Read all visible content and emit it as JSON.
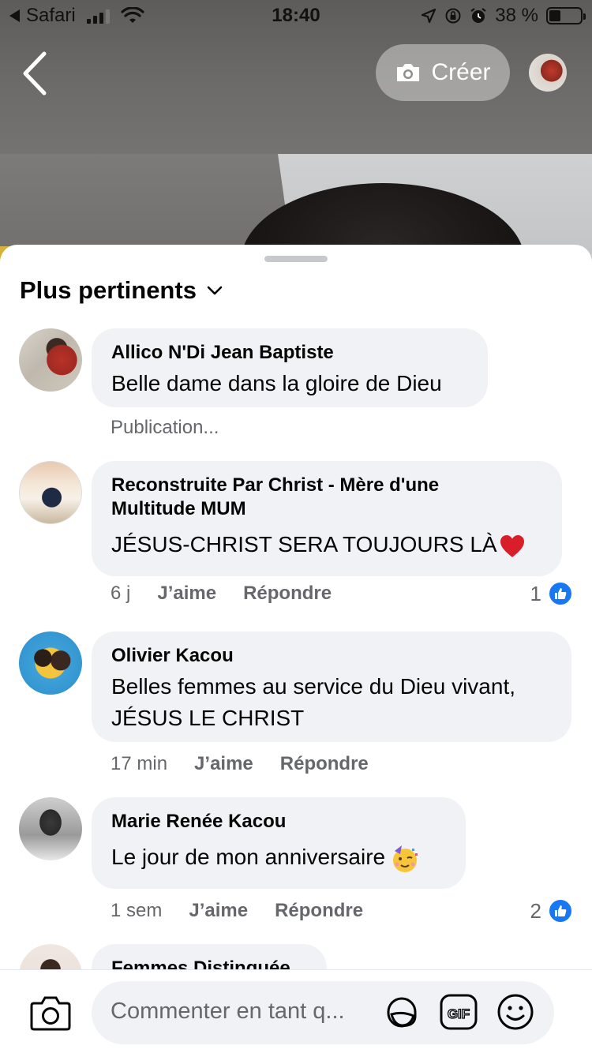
{
  "status_bar": {
    "back_app": "Safari",
    "time": "18:40",
    "battery_percent": "38 %",
    "battery_level": 0.38
  },
  "top_bar": {
    "create_label": "Créer"
  },
  "sheet": {
    "sort_label": "Plus pertinents",
    "comments": [
      {
        "author": "Allico N'Di Jean Baptiste",
        "text": "Belle dame dans la gloire de Dieu",
        "status": "Publication..."
      },
      {
        "author_line1": "Reconstruite Par Christ - Mère d'une",
        "author_line2": "Multitude MUM",
        "text": "JÉSUS-CHRIST SERA TOUJOURS LÀ",
        "emoji": "red-heart",
        "time": "6 j",
        "like": "J’aime",
        "reply": "Répondre",
        "reactions": "1"
      },
      {
        "author": "Olivier Kacou",
        "text_line1": "Belles femmes au service du Dieu vivant,",
        "text_line2": "JÉSUS LE CHRIST",
        "time": "17 min",
        "like": "J’aime",
        "reply": "Répondre"
      },
      {
        "author": "Marie Renée Kacou",
        "text": "Le jour de mon anniversaire",
        "emoji": "partying-face",
        "time": "1 sem",
        "like": "J’aime",
        "reply": "Répondre",
        "reactions": "2"
      },
      {
        "author": "Femmes Distinguée"
      }
    ]
  },
  "composer": {
    "placeholder": "Commenter en tant q...",
    "icons": [
      "camera-icon",
      "sticker-icon",
      "gif-icon",
      "emoji-icon"
    ]
  },
  "colors": {
    "accent": "#1877f2",
    "bubble": "#f0f2f5",
    "meta_text": "#65676b"
  }
}
